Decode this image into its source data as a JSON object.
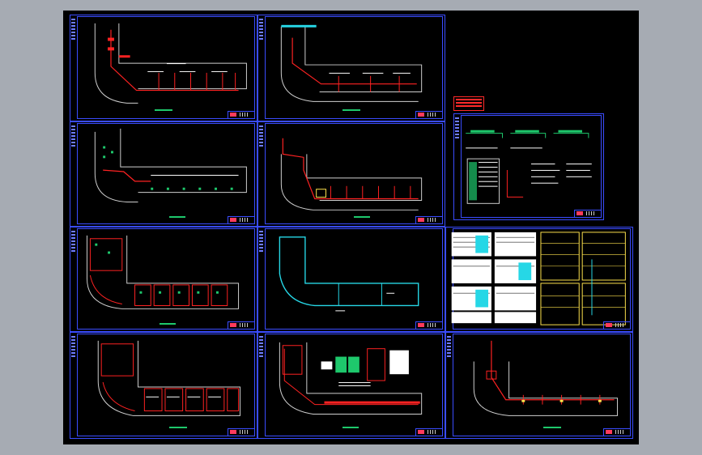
{
  "viewer": {
    "background_color": "#a6abb3",
    "canvas_color": "#000000",
    "frame_color": "#3a4cff"
  },
  "colors": {
    "wall": "#cfcfcf",
    "wiring_red": "#ff2222",
    "wiring_green": "#1ec86c",
    "text_white": "#ffffff",
    "cyan": "#26d7e6",
    "yellow": "#ffe34d"
  },
  "sheets": [
    {
      "id": "sheet-1",
      "content": "floor-plan-wiring-top"
    },
    {
      "id": "sheet-2",
      "content": "floor-plan-wiring-upper"
    },
    {
      "id": "sheet-3",
      "content": "floor-plan-lighting"
    },
    {
      "id": "sheet-4",
      "content": "floor-plan-power"
    },
    {
      "id": "sheet-5",
      "content": "system-diagram"
    },
    {
      "id": "sheet-6",
      "content": "floor-plan-dense-red"
    },
    {
      "id": "sheet-7",
      "content": "floor-plan-outline-cyan"
    },
    {
      "id": "sheet-8",
      "content": "distribution-tables"
    },
    {
      "id": "sheet-9",
      "content": "floor-plan-dense-red-2"
    },
    {
      "id": "sheet-10",
      "content": "floor-plan-with-legend"
    },
    {
      "id": "sheet-11",
      "content": "floor-plan-riser"
    }
  ]
}
